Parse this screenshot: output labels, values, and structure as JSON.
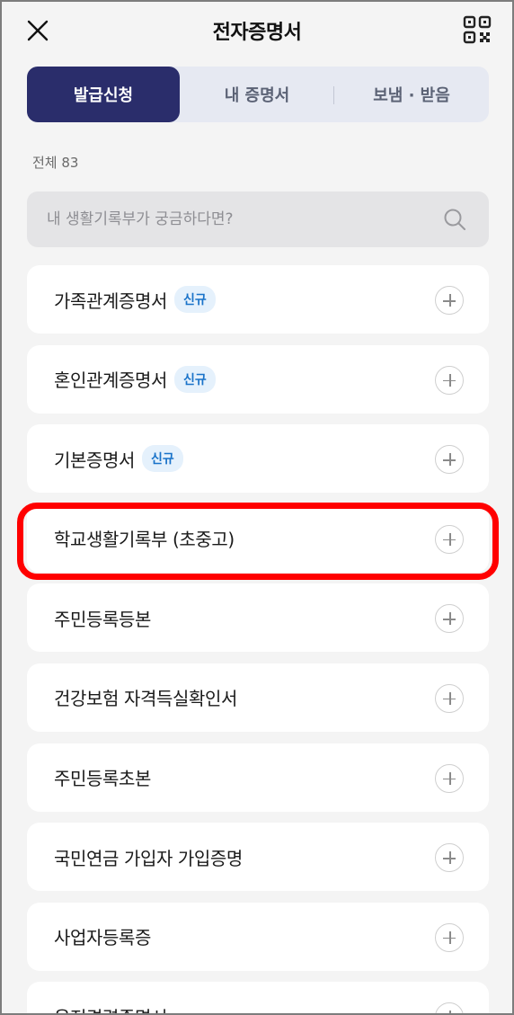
{
  "header": {
    "title": "전자증명서",
    "close_icon": "close-icon",
    "qr_icon": "qr-code-icon"
  },
  "tabs": [
    {
      "label": "발급신청",
      "active": true
    },
    {
      "label": "내 증명서",
      "active": false
    },
    {
      "label": "보냄 · 받음",
      "active": false
    }
  ],
  "count_text": "전체 83",
  "search": {
    "placeholder": "내 생활기록부가 궁금하다면?",
    "value": "",
    "icon": "search-icon"
  },
  "items": [
    {
      "label": "가족관계증명서",
      "badge": "신규"
    },
    {
      "label": "혼인관계증명서",
      "badge": "신규"
    },
    {
      "label": "기본증명서",
      "badge": "신규"
    },
    {
      "label": "학교생활기록부 (초중고)",
      "badge": "",
      "highlighted": true
    },
    {
      "label": "주민등록등본",
      "badge": ""
    },
    {
      "label": "건강보험 자격득실확인서",
      "badge": ""
    },
    {
      "label": "주민등록초본",
      "badge": ""
    },
    {
      "label": "국민연금 가입자 가입증명",
      "badge": ""
    },
    {
      "label": "사업자등록증",
      "badge": ""
    },
    {
      "label": "운전경력증명서",
      "badge": ""
    }
  ],
  "colors": {
    "active_tab": "#2a2d6b",
    "badge_text": "#1a73c9",
    "badge_bg": "#e5f1fc",
    "highlight": "#ff0000"
  }
}
